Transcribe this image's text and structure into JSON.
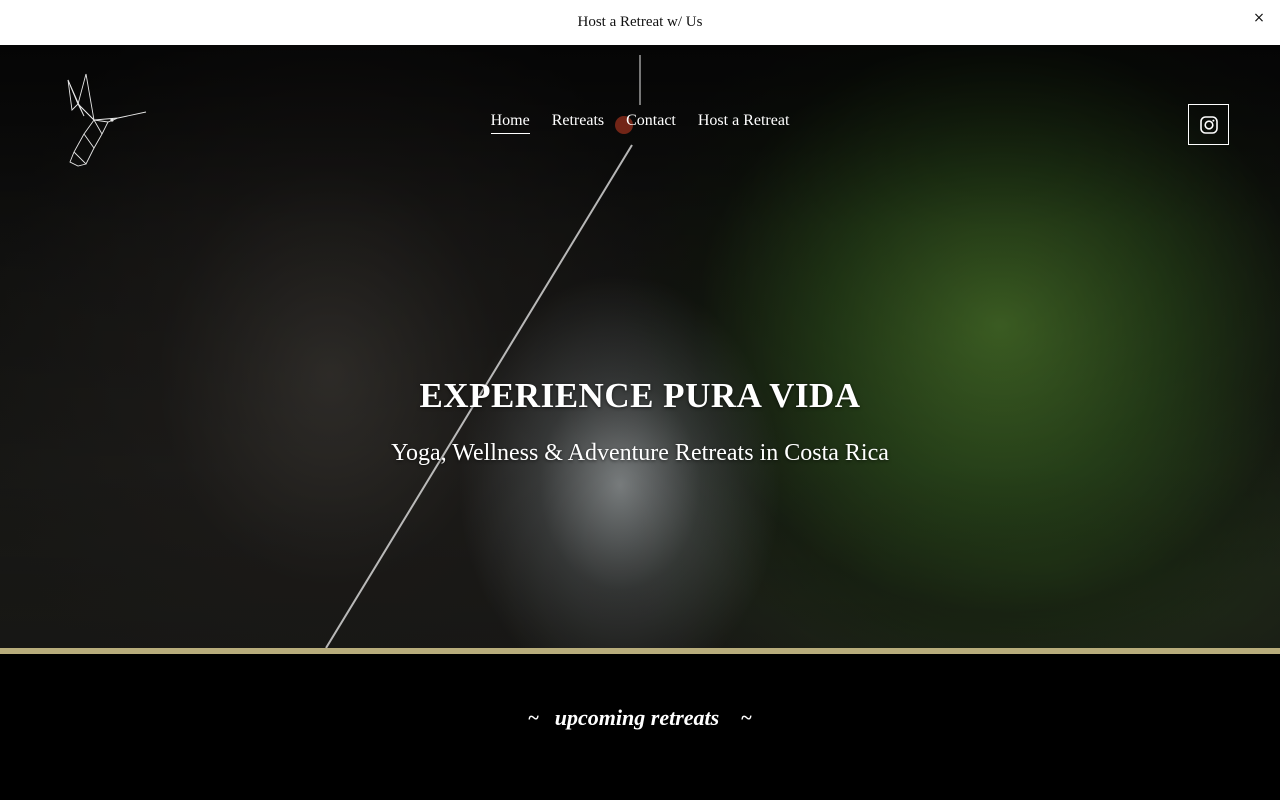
{
  "announcement": {
    "text": "Host a Retreat w/ Us",
    "close_glyph": "×"
  },
  "header": {
    "logo_icon": "hummingbird-logo-icon",
    "nav": [
      {
        "label": "Home",
        "active": true
      },
      {
        "label": "Retreats",
        "active": false
      },
      {
        "label": "Contact",
        "active": false
      },
      {
        "label": "Host a Retreat",
        "active": false
      }
    ],
    "social_icon": "instagram-icon"
  },
  "hero": {
    "title": "EXPERIENCE PURA VIDA",
    "subtitle": "Yoga, Wellness & Adventure Retreats in Costa Rica"
  },
  "section": {
    "tilde_left": "~",
    "title": "upcoming retreats",
    "tilde_right": "~"
  },
  "colors": {
    "accent_line": "#b8ad7c",
    "text": "#ffffff",
    "announcement_bg": "#ffffff"
  }
}
